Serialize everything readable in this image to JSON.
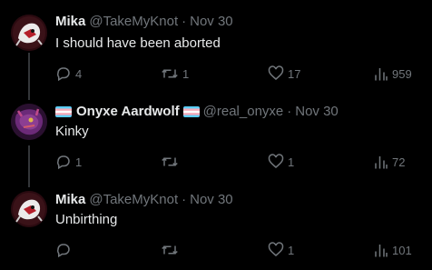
{
  "tweets": [
    {
      "display_name": "Mika",
      "handle": "@TakeMyKnot",
      "separator": "·",
      "date": "Nov 30",
      "text": "I should have been aborted",
      "replies": "4",
      "retweets": "1",
      "likes": "17",
      "views": "959",
      "avatar_icon": "white-creature-avatar-icon"
    },
    {
      "display_name": "Onyxe Aardwolf",
      "handle": "@real_onyxe",
      "separator": "·",
      "date": "Nov 30",
      "text": "Kinky",
      "replies": "1",
      "retweets": "",
      "likes": "1",
      "views": "72",
      "avatar_icon": "purple-hyena-avatar-icon",
      "name_emoji": "transgender-flag-icon"
    },
    {
      "display_name": "Mika",
      "handle": "@TakeMyKnot",
      "separator": "·",
      "date": "Nov 30",
      "text": "Unbirthing",
      "replies": "",
      "retweets": "",
      "likes": "1",
      "views": "101",
      "avatar_icon": "white-creature-avatar-icon"
    }
  ],
  "colors": {
    "background": "#000000",
    "primary_text": "#e7e9ea",
    "secondary_text": "#71767b",
    "thread_line": "#333639",
    "trans_blue": "#5BCEFA",
    "trans_pink": "#F5A9B8",
    "trans_white": "#FFFFFF"
  }
}
